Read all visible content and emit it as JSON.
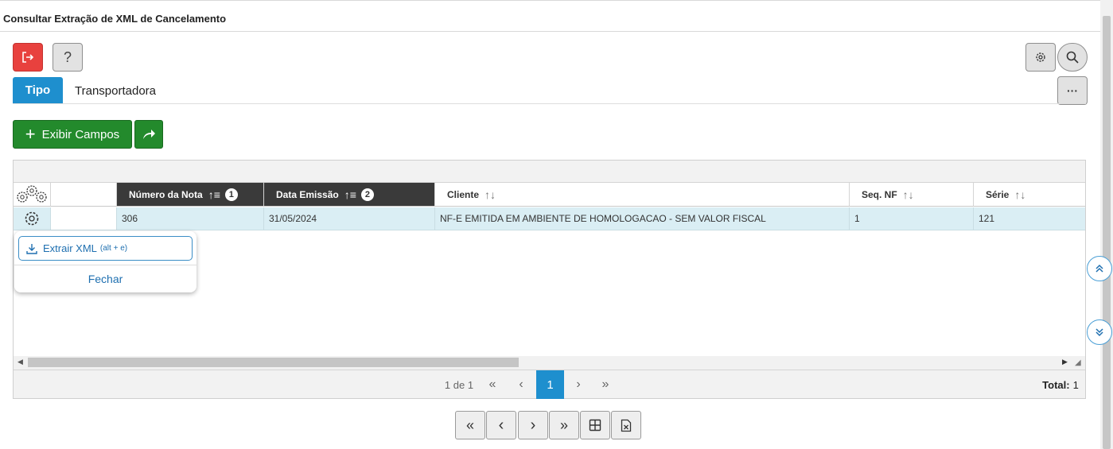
{
  "window": {
    "title": "Consultar Extração de XML de Cancelamento"
  },
  "toolbar": {
    "exit_icon": "exit-icon",
    "help_label": "?",
    "settings_icon": "gear-icon",
    "search_icon": "search-icon",
    "more_label": "···"
  },
  "tabs": [
    {
      "label": "Tipo",
      "active": true
    },
    {
      "label": "Transportadora",
      "active": false
    }
  ],
  "actions": {
    "show_fields_label": "Exibir Campos",
    "plus_label": "+",
    "share_icon": "share-icon"
  },
  "grid": {
    "columns": [
      {
        "label": "Número da Nota",
        "sort_order": "1",
        "sorted": true
      },
      {
        "label": "Data Emissão",
        "sort_order": "2",
        "sorted": true
      },
      {
        "label": "Cliente",
        "sorted": false
      },
      {
        "label": "Seq. NF",
        "sorted": false
      },
      {
        "label": "Série",
        "sorted": false
      }
    ],
    "rows": [
      {
        "numero": "306",
        "data": "31/05/2024",
        "cliente": "NF-E EMITIDA EM AMBIENTE DE HOMOLOGACAO - SEM VALOR FISCAL",
        "seq": "1",
        "serie": "121"
      }
    ]
  },
  "row_menu": {
    "extract_label": "Extrair XML",
    "extract_shortcut": "(alt + e)",
    "close_label": "Fechar"
  },
  "pagination": {
    "info": "1 de 1",
    "first": "«",
    "prev": "‹",
    "current": "1",
    "next": "›",
    "last": "»",
    "total_label": "Total:",
    "total_value": "1"
  },
  "bottom_nav": {
    "first": "«",
    "prev": "‹",
    "next": "›",
    "last": "»"
  },
  "colors": {
    "accent": "#1e8fce",
    "exit": "#e8413e",
    "green": "#238a2c",
    "header_dark": "#3a3a3a",
    "row_selected": "#daeef4"
  }
}
